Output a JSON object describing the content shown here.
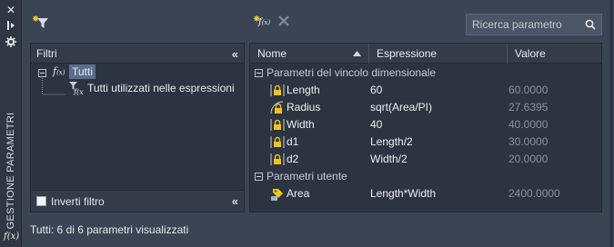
{
  "sidebar": {
    "title": "GESTIONE PARAMETRI",
    "fx_glyph": "f(x)"
  },
  "toolbar": {
    "new_filter_icon": "filter-star-icon",
    "new_param_icon": "fx-star-icon",
    "delete_icon": "delete-x-icon",
    "search_placeholder": "Ricerca parametro"
  },
  "filters": {
    "header": "Filtri",
    "tree": [
      {
        "label": "Tutti",
        "selected": true
      },
      {
        "label": "Tutti utilizzati nelle espressioni",
        "selected": false
      }
    ],
    "invert_label": "Inverti filtro",
    "invert_checked": false
  },
  "grid": {
    "columns": [
      "Nome",
      "Espressione",
      "Valore"
    ],
    "sort_column": "Nome",
    "groups": [
      {
        "label": "Parametri del vincolo dimensionale",
        "rows": [
          {
            "name": "Length",
            "expression": "60",
            "value": "60.0000",
            "icon": "linear-lock-icon"
          },
          {
            "name": "Radius",
            "expression": "sqrt(Area/PI)",
            "value": "27.6395",
            "icon": "radial-lock-icon"
          },
          {
            "name": "Width",
            "expression": "40",
            "value": "40.0000",
            "icon": "linear-lock-icon"
          },
          {
            "name": "d1",
            "expression": "Length/2",
            "value": "30.0000",
            "icon": "linear-lock-icon"
          },
          {
            "name": "d2",
            "expression": "Width/2",
            "value": "20.0000",
            "icon": "linear-lock-icon"
          }
        ]
      },
      {
        "label": "Parametri utente",
        "rows": [
          {
            "name": "Area",
            "expression": "Length*Width",
            "value": "2400.0000",
            "icon": "user-param-icon"
          }
        ]
      }
    ]
  },
  "status": "Tutti: 6 di 6 parametri visualizzati",
  "colors": {
    "background": "#3b4453",
    "panel": "#2d3441",
    "selection": "#5a6d8c",
    "lock": "#f0c419"
  }
}
